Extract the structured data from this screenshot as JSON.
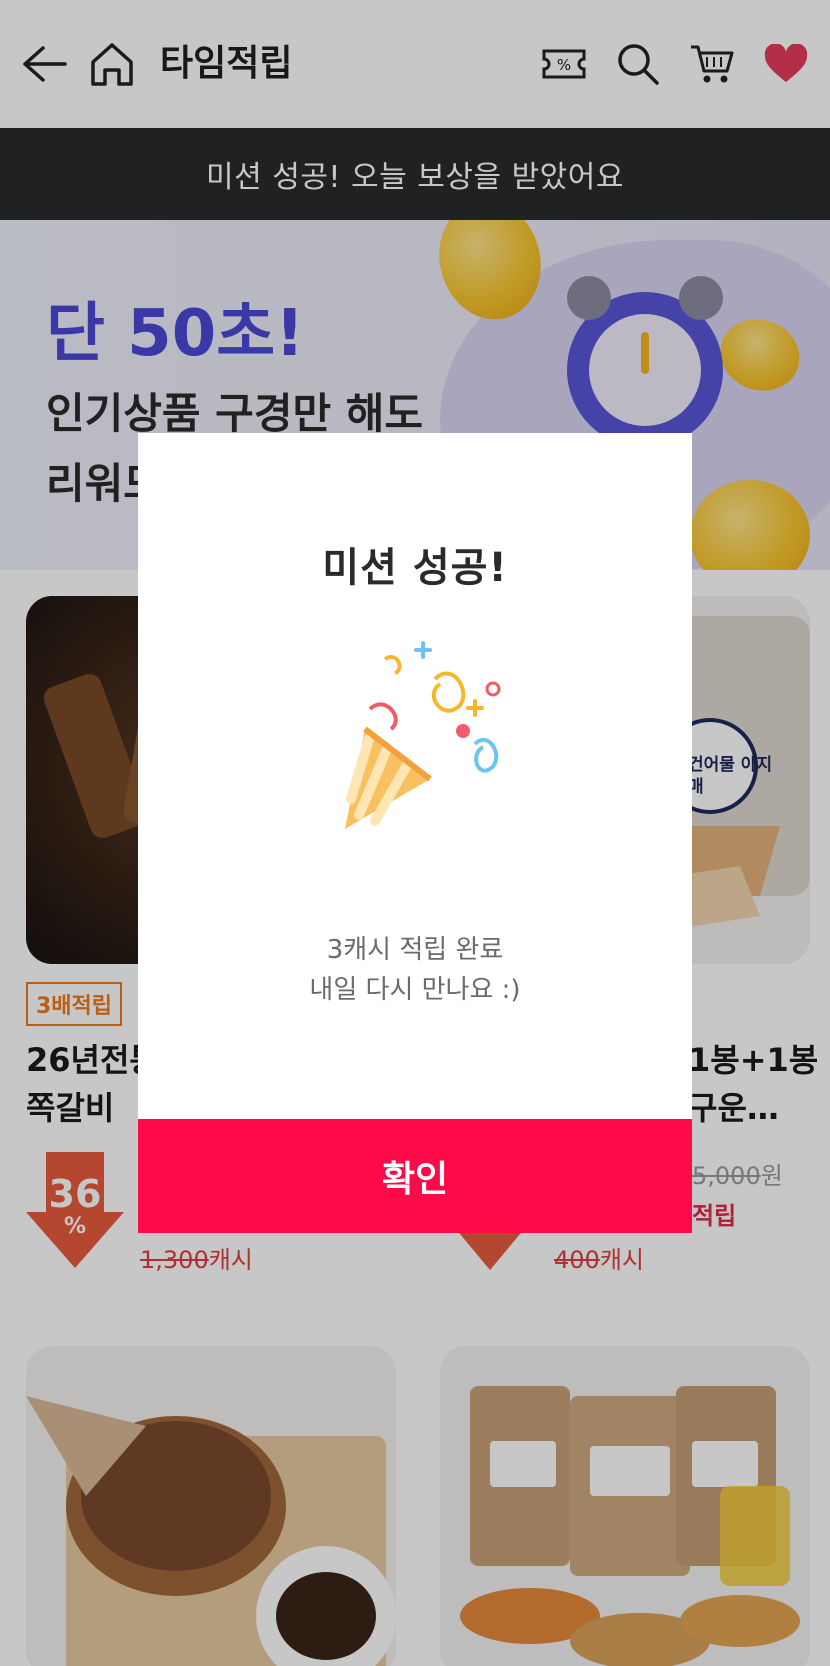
{
  "header": {
    "title": "타임적립"
  },
  "mission_banner": {
    "text": "미션 성공! 오늘 보상을 받았어요"
  },
  "hero": {
    "accent": "단 50초!",
    "line1": "인기상품 구경만 해도",
    "line2_visible": "리워드"
  },
  "products": [
    {
      "badge": "3배적립",
      "name_line1": "26년전통",
      "name_line2": "쪽갈비",
      "discount": "36",
      "discount_unit": "%",
      "original_cash": "1,300",
      "cash_unit": "캐시"
    },
    {
      "name_line1": "1봉+1봉",
      "name_line2": "구운…",
      "original_price": "5,000",
      "price_unit": "원",
      "reward_text": "적립",
      "original_cash": "400",
      "cash_unit": "캐시",
      "package_label": "건어물 아지매"
    }
  ],
  "modal": {
    "title": "미션 성공!",
    "message_line1": "3캐시 적립 완료",
    "message_line2": "내일 다시 만나요 :)",
    "confirm_label": "확인"
  },
  "colors": {
    "accent_red": "#ff0a49",
    "banner_dark": "#2a2b2e",
    "hero_accent": "#4b48d6",
    "heart": "#e63a5c"
  }
}
